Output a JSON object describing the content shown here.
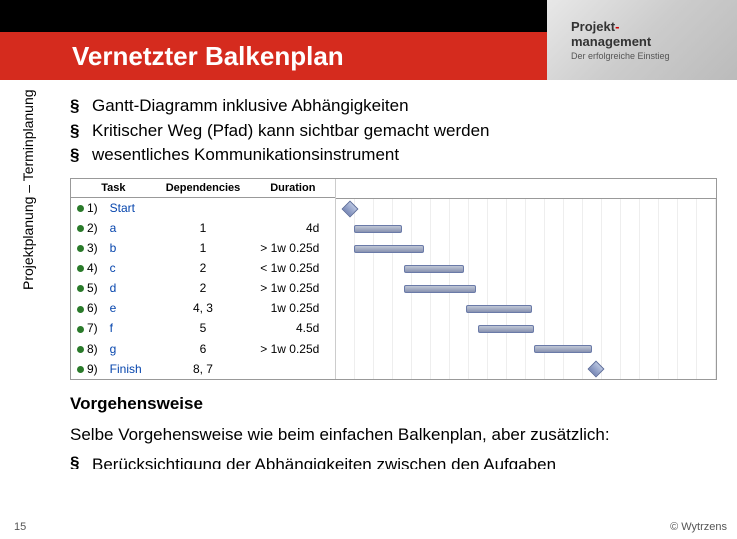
{
  "header": {
    "title": "Vernetzter Balkenplan",
    "logo_l1a": "Projekt",
    "logo_l1b": "-",
    "logo_l2": "management",
    "logo_l3": "Der erfolgreiche Einstieg"
  },
  "bullets": [
    "Gantt-Diagramm inklusive Abhängigkeiten",
    "Kritischer Weg (Pfad) kann sichtbar gemacht werden",
    "wesentliches Kommunikationsinstrument"
  ],
  "sidebar": "Projektplanung – Terminplanung",
  "chart_data": {
    "type": "table",
    "headers": {
      "task": "Task",
      "dep": "Dependencies",
      "dur": "Duration"
    },
    "rows": [
      {
        "idx": "1)",
        "name": "Start",
        "dep": "",
        "dur": ""
      },
      {
        "idx": "2)",
        "name": "a",
        "dep": "1",
        "dur": "4d"
      },
      {
        "idx": "3)",
        "name": "b",
        "dep": "1",
        "dur": "> 1w 0.25d"
      },
      {
        "idx": "4)",
        "name": "c",
        "dep": "2",
        "dur": "< 1w 0.25d"
      },
      {
        "idx": "5)",
        "name": "d",
        "dep": "2",
        "dur": "> 1w 0.25d"
      },
      {
        "idx": "6)",
        "name": "e",
        "dep": "4, 3",
        "dur": "1w 0.25d"
      },
      {
        "idx": "7)",
        "name": "f",
        "dep": "5",
        "dur": "4.5d"
      },
      {
        "idx": "8)",
        "name": "g",
        "dep": "6",
        "dur": "> 1w 0.25d"
      },
      {
        "idx": "9)",
        "name": "Finish",
        "dep": "8, 7",
        "dur": ""
      }
    ]
  },
  "section": {
    "heading": "Vorgehensweise",
    "text": "Selbe Vorgehensweise wie beim einfachen Balkenplan, aber zusätzlich:",
    "cutoff": "Berücksichtigung der Abhängigkeiten zwischen den Aufgaben"
  },
  "footer": {
    "page": "15",
    "copyright": "© Wytrzens"
  }
}
